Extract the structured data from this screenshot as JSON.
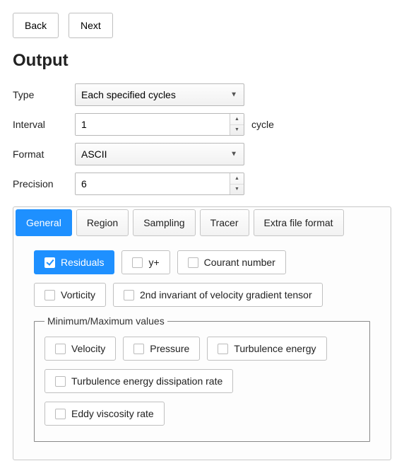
{
  "nav": {
    "back": "Back",
    "next": "Next"
  },
  "title": "Output",
  "form": {
    "type_label": "Type",
    "type_value": "Each specified cycles",
    "interval_label": "Interval",
    "interval_value": "1",
    "interval_unit": "cycle",
    "format_label": "Format",
    "format_value": "ASCII",
    "precision_label": "Precision",
    "precision_value": "6"
  },
  "tabs": {
    "general": "General",
    "region": "Region",
    "sampling": "Sampling",
    "tracer": "Tracer",
    "extra": "Extra file format",
    "active": "general"
  },
  "checks": {
    "residuals": "Residuals",
    "yplus": "y+",
    "courant": "Courant number",
    "vorticity": "Vorticity",
    "second_inv": "2nd invariant of velocity gradient tensor"
  },
  "minmax": {
    "legend": "Minimum/Maximum values",
    "velocity": "Velocity",
    "pressure": "Pressure",
    "turb_energy": "Turbulence energy",
    "turb_diss": "Turbulence energy dissipation rate",
    "eddy_visc": "Eddy viscosity rate"
  }
}
